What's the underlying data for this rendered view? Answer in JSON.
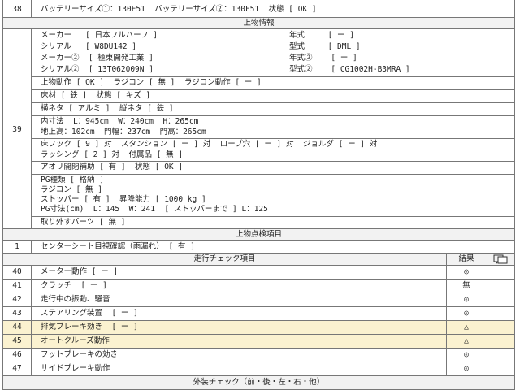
{
  "battery_row": {
    "num": "38",
    "text": "バッテリーサイズ①：130F51  バッテリーサイズ②：130F51  状態 [ OK ]"
  },
  "upper_section": {
    "header": "上物情報",
    "num": "39",
    "maker1": "メーカー   [ 日本フルハーフ ]",
    "year1": "年式     [ ー ]",
    "serial1": "シリアル   [ W8DU142 ]",
    "model1": "型式     [ DML ]",
    "maker2": "メーカー②  [ 極東開発工業 ]",
    "year2": "年式②    [ ー ]",
    "serial2": "シリアル②  [ 13T062009N ]",
    "model2": "型式②    [ CG1002H-B3MRA ]",
    "operation": "上物動作 [ OK ]  ラジコン [ 無 ]  ラジコン動作 [ ー ]",
    "floor": "床材 [ 鉄 ]  状態 [ キズ ]",
    "beams": "横ネタ [ アルミ ]  縦ネタ [ 鉄 ]",
    "dims1": "内寸法  L：945cm  W：240cm  H：265cm",
    "dims2": "地上高：102cm  門幅：237cm  門高：265cm",
    "hooks1": "床フック [ 9 ] 対  スタンション [ ー ] 対  ロープ穴 [ ー ] 対  ジョルダ [ ー ] 対",
    "hooks2": "ラッシング [ 2 ] 対  付属品 [ 無 ]",
    "tailgate": "アオリ開閉補助 [ 有 ]  状態 [ OK ]",
    "pg1": "PG種類 [ 格納 ]",
    "pg2": "ラジコン [ 無 ]",
    "pg3": "ストッパー [ 有 ]  昇降能力 [ 1000 kg ]",
    "pg4": "PG寸法(cm)  L：145  W：241  [ ストッパーまで ] L：125",
    "removable": "取り外すパーツ [ 無 ]"
  },
  "inspection_section": {
    "header": "上物点検項目",
    "num": "1",
    "text": "センターシート目視確認（雨漏れ） [ 有 ]"
  },
  "drive_check": {
    "header": "走行チェック項目",
    "result_header": "結果",
    "comment_icon": "comment-icon",
    "items": [
      {
        "num": "40",
        "label": "メーター動作 [ ー ]",
        "result": "◎"
      },
      {
        "num": "41",
        "label": "クラッチ  [ ー ]",
        "result": "無"
      },
      {
        "num": "42",
        "label": "走行中の振動、騒音",
        "result": "◎"
      },
      {
        "num": "43",
        "label": "ステアリング装置  [ ー ]",
        "result": "◎"
      },
      {
        "num": "44",
        "label": "排気ブレーキ効き  [ ー ]",
        "result": "△"
      },
      {
        "num": "45",
        "label": "オートクルーズ動作",
        "result": "△"
      },
      {
        "num": "46",
        "label": "フットブレーキの効き",
        "result": "◎"
      },
      {
        "num": "47",
        "label": "サイドブレーキ動作",
        "result": "◎"
      }
    ]
  },
  "exterior_section": {
    "header": "外装チェック（前・後・左・右・他）"
  },
  "colors": {
    "highlight": "#fbf2d0",
    "header_bg": "#f2f2f2",
    "border": "#777777"
  }
}
